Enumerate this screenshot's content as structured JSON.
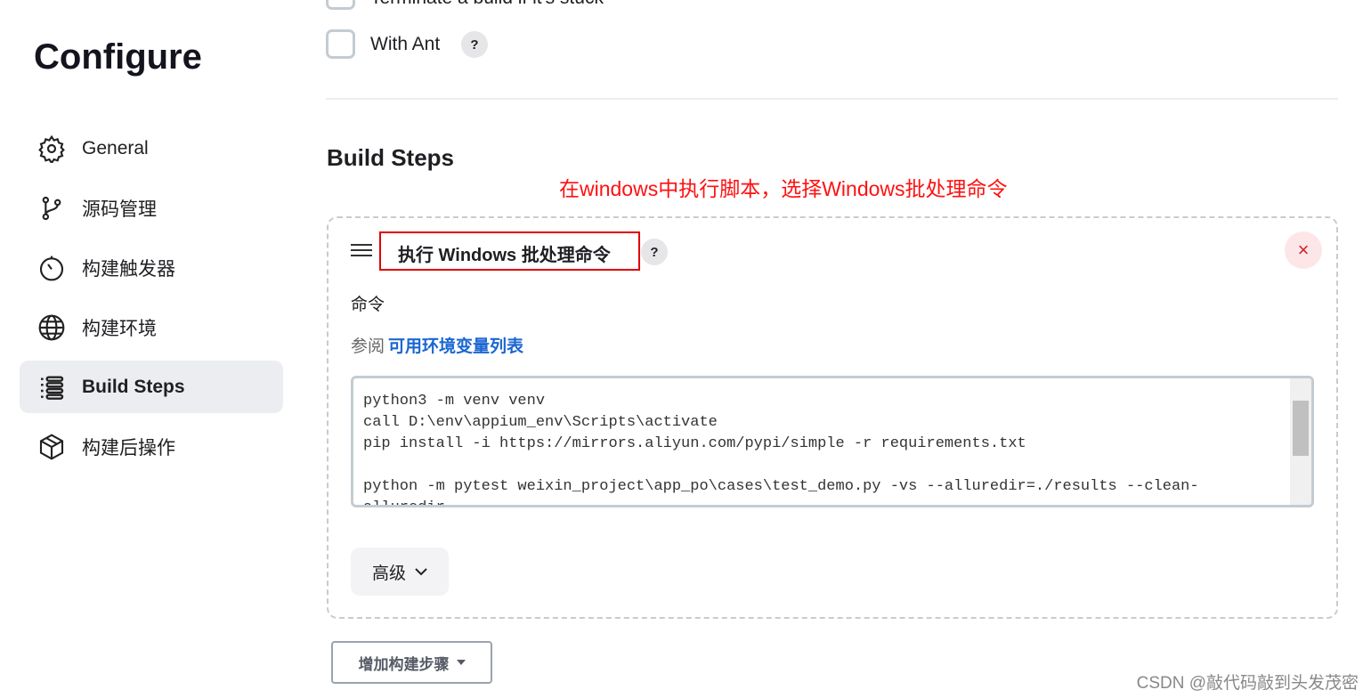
{
  "title": "Configure",
  "sidebar": {
    "items": [
      {
        "label": "General",
        "icon": "gear-icon"
      },
      {
        "label": "源码管理",
        "icon": "branch-icon"
      },
      {
        "label": "构建触发器",
        "icon": "timer-icon"
      },
      {
        "label": "构建环境",
        "icon": "globe-icon"
      },
      {
        "label": "Build Steps",
        "icon": "list-icon",
        "active": true
      },
      {
        "label": "构建后操作",
        "icon": "package-icon"
      }
    ]
  },
  "options": [
    {
      "label": "Terminate a build if it's stuck"
    },
    {
      "label": "With Ant",
      "help": "?"
    }
  ],
  "section_title": "Build Steps",
  "annotation": "在windows中执行脚本，选择Windows批处理命令",
  "step": {
    "title": "执行 Windows 批处理命令",
    "help": "?",
    "close": "×",
    "command_label": "命令",
    "see_prefix": "参阅",
    "env_link": "可用环境变量列表",
    "command": "python3 -m venv venv\ncall D:\\env\\appium_env\\Scripts\\activate\npip install -i https://mirrors.aliyun.com/pypi/simple -r requirements.txt\n\npython -m pytest weixin_project\\app_po\\cases\\test_demo.py -vs --alluredir=./results --clean-\nalluredir",
    "advanced": "高级"
  },
  "add_step": "增加构建步骤",
  "watermark": "CSDN @敲代码敲到头发茂密",
  "colors": {
    "annotation": "#ff1010",
    "link": "#1b66d2",
    "close": "#d0202b"
  }
}
